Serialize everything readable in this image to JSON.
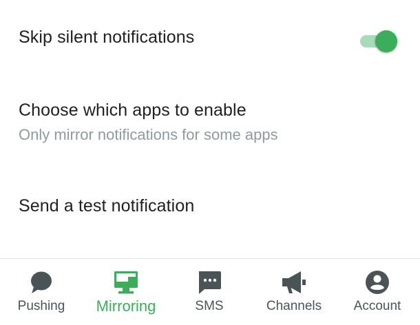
{
  "settings": {
    "skip_silent": {
      "title": "Skip silent notifications",
      "enabled": true
    },
    "choose_apps": {
      "title": "Choose which apps to enable",
      "summary": "Only mirror notifications for some apps"
    },
    "test_notification": {
      "title": "Send a test notification"
    }
  },
  "bottom_nav": {
    "active": "mirroring",
    "items": [
      {
        "id": "pushing",
        "label": "Pushing",
        "icon": "chat-bubble-icon"
      },
      {
        "id": "mirroring",
        "label": "Mirroring",
        "icon": "monitor-icon"
      },
      {
        "id": "sms",
        "label": "SMS",
        "icon": "sms-icon"
      },
      {
        "id": "channels",
        "label": "Channels",
        "icon": "megaphone-icon"
      },
      {
        "id": "account",
        "label": "Account",
        "icon": "account-circle-icon"
      }
    ]
  },
  "colors": {
    "accent": "#3bae5c",
    "toggle_track": "#a8dbb8",
    "inactive_icon": "#4a5457",
    "summary_text": "#8f9aa0",
    "title_text": "#212121"
  }
}
